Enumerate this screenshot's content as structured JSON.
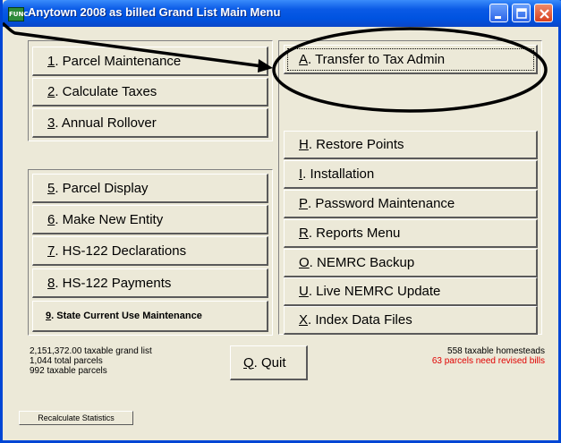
{
  "window": {
    "icon_text": "FUNC",
    "title": "Anytown 2008 as billed Grand List Main Menu",
    "controls": [
      "minimize",
      "maximize",
      "close"
    ]
  },
  "left_top": [
    {
      "key": "1",
      "label": ". Parcel Maintenance"
    },
    {
      "key": "2",
      "label": ". Calculate Taxes"
    },
    {
      "key": "3",
      "label": ". Annual Rollover"
    }
  ],
  "left_bottom": [
    {
      "key": "5",
      "label": ". Parcel Display"
    },
    {
      "key": "6",
      "label": ". Make New Entity"
    },
    {
      "key": "7",
      "label": ". HS-122 Declarations"
    },
    {
      "key": "8",
      "label": ". HS-122 Payments"
    },
    {
      "key": "9",
      "label": ". State Current Use Maintenance"
    }
  ],
  "right_top": {
    "key": "A",
    "label": ". Transfer to Tax Admin"
  },
  "right_list": [
    {
      "key": "H",
      "label": ". Restore Points"
    },
    {
      "key": "I",
      "label": ". Installation"
    },
    {
      "key": "P",
      "label": ". Password Maintenance"
    },
    {
      "key": "R",
      "label": ". Reports Menu"
    },
    {
      "key": "O",
      "label": ". NEMRC Backup"
    },
    {
      "key": "U",
      "label": ". Live NEMRC Update"
    },
    {
      "key": "X",
      "label": ". Index Data Files"
    }
  ],
  "quit": {
    "key": "Q",
    "label": ". Quit"
  },
  "stats": {
    "grand_list": "2,151,372.00 taxable grand list",
    "total_parcels": "1,044 total parcels",
    "taxable_parcels": "992 taxable parcels",
    "homesteads": "558 taxable homesteads",
    "revised_bills": "63 parcels need revised bills"
  },
  "recalc_label": "Recalculate Statistics",
  "colors": {
    "title_bar": "#0053e0",
    "face": "#ece9d8",
    "alert": "#e00000",
    "annotation": "#000000"
  }
}
